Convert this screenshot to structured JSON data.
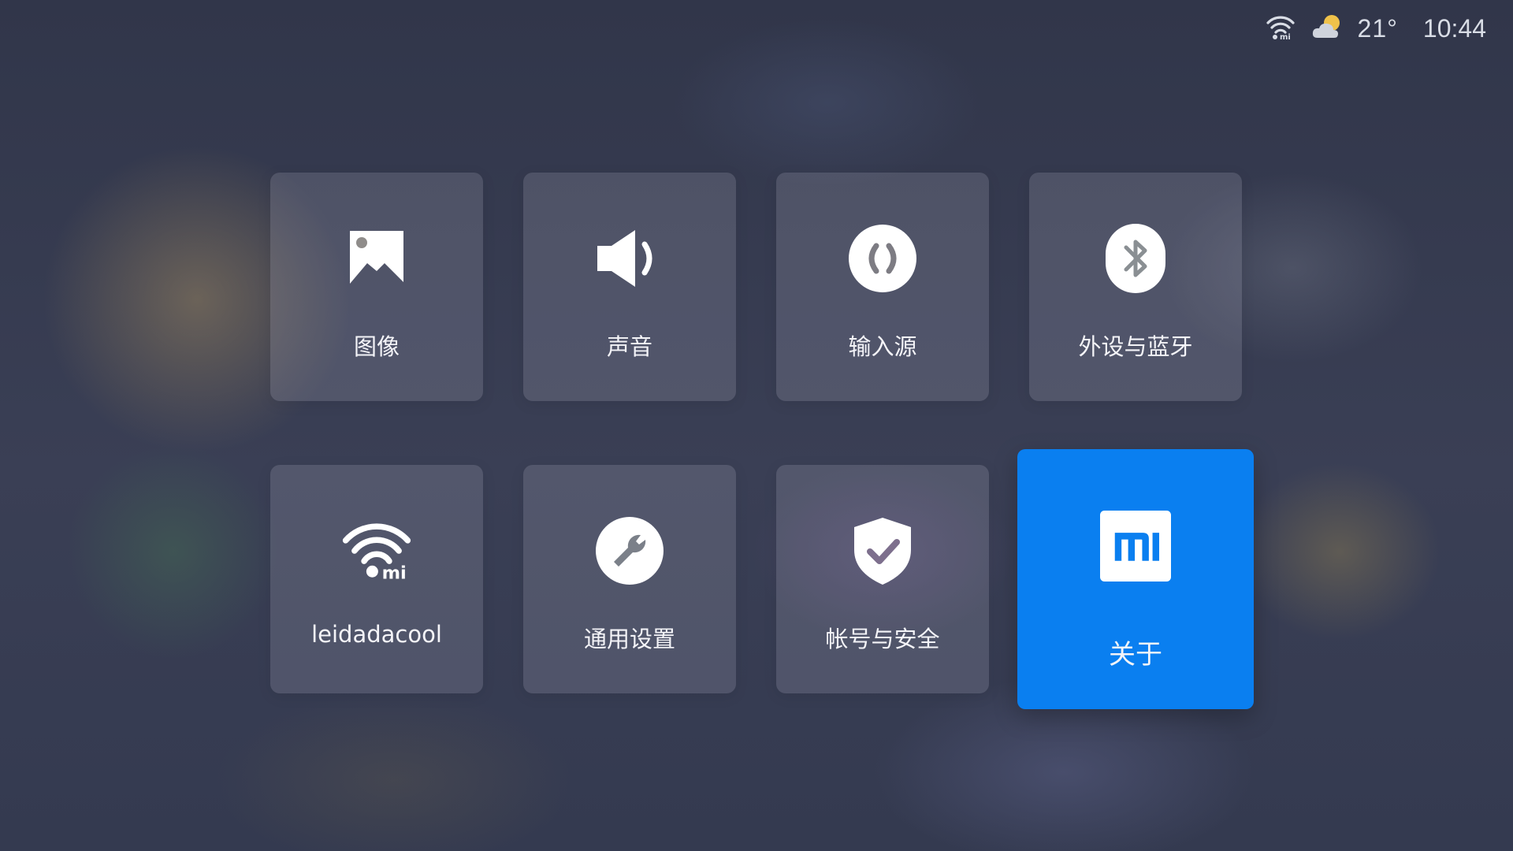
{
  "status_bar": {
    "wifi_icon": "wifi-mi-icon",
    "weather_icon": "partly-cloudy-icon",
    "temperature": "21°",
    "time": "10:44"
  },
  "settings_tiles": [
    {
      "label": "图像",
      "icon": "image-icon"
    },
    {
      "label": "声音",
      "icon": "speaker-icon"
    },
    {
      "label": "输入源",
      "icon": "input-source-icon"
    },
    {
      "label": "外设与蓝牙",
      "icon": "bluetooth-icon"
    },
    {
      "label": "leidadacool",
      "icon": "wifi-mi-icon"
    },
    {
      "label": "通用设置",
      "icon": "wrench-icon"
    },
    {
      "label": "帐号与安全",
      "icon": "shield-check-icon"
    },
    {
      "label": "关于",
      "icon": "mi-logo-icon",
      "selected": true
    }
  ],
  "colors": {
    "selected_tile": "#0a7ff0",
    "tile_background": "rgba(175,175,190,0.22)",
    "icon": "#ffffff"
  }
}
